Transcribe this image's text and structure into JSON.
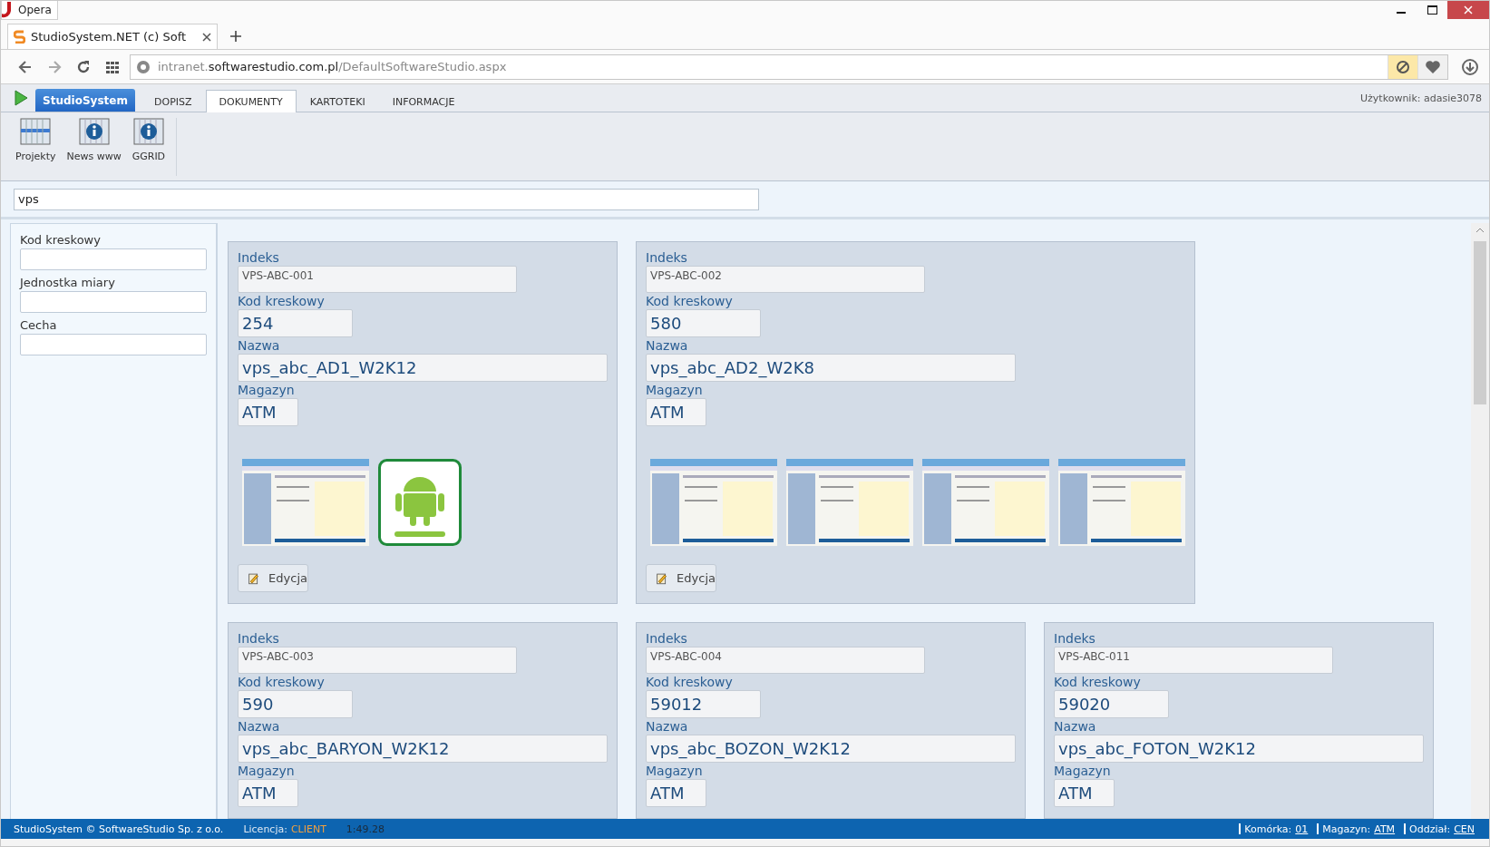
{
  "browser": {
    "title": "Opera",
    "tab": {
      "title": "StudioSystem.NET (c) Soft"
    },
    "url": {
      "prefix": "intranet.",
      "domain": "softwarestudio.com.pl",
      "path": "/DefaultSoftwareStudio.aspx"
    }
  },
  "menu": {
    "brand": "StudioSystem",
    "tabs": [
      {
        "label": "DOPISZ",
        "selected": false
      },
      {
        "label": "DOKUMENTY",
        "selected": true
      },
      {
        "label": "KARTOTEKI",
        "selected": false
      },
      {
        "label": "INFORMACJE",
        "selected": false
      }
    ],
    "user": "Użytkownik: adasie3078"
  },
  "ribbon": [
    {
      "label": "Projekty",
      "kind": "calendar"
    },
    {
      "label": "News www",
      "kind": "info"
    },
    {
      "label": "GGRID",
      "kind": "info"
    }
  ],
  "search": {
    "value": "vps"
  },
  "filters": [
    {
      "label": "Kod kreskowy"
    },
    {
      "label": "Jednostka miary"
    },
    {
      "label": "Cecha"
    }
  ],
  "cards": [
    {
      "fields": [
        {
          "label": "Indeks",
          "value": "VPS-ABC-001",
          "kind": "small"
        },
        {
          "label": "Kod kreskowy",
          "value": "254",
          "kind": "short"
        },
        {
          "label": "Nazwa",
          "value": "vps_abc_AD1_W2K12",
          "kind": "wide"
        },
        {
          "label": "Magazyn",
          "value": "ATM",
          "kind": "tiny"
        }
      ],
      "images": [
        {
          "kind": "screenshot"
        },
        {
          "kind": "logo"
        }
      ],
      "action": "Edycja"
    },
    {
      "fields": [
        {
          "label": "Indeks",
          "value": "VPS-ABC-002",
          "kind": "small"
        },
        {
          "label": "Kod kreskowy",
          "value": "580",
          "kind": "short"
        },
        {
          "label": "Nazwa",
          "value": "vps_abc_AD2_W2K8",
          "kind": "wide"
        },
        {
          "label": "Magazyn",
          "value": "ATM",
          "kind": "tiny"
        }
      ],
      "images": [
        {
          "kind": "screenshot"
        },
        {
          "kind": "screenshot"
        },
        {
          "kind": "screenshot"
        },
        {
          "kind": "screenshot"
        }
      ],
      "action": "Edycja"
    },
    {
      "fields": [
        {
          "label": "Indeks",
          "value": "VPS-ABC-003",
          "kind": "small"
        },
        {
          "label": "Kod kreskowy",
          "value": "590",
          "kind": "short"
        },
        {
          "label": "Nazwa",
          "value": "vps_abc_BARYON_W2K12",
          "kind": "wide"
        },
        {
          "label": "Magazyn",
          "value": "ATM",
          "kind": "tiny"
        }
      ]
    },
    {
      "fields": [
        {
          "label": "Indeks",
          "value": "VPS-ABC-004",
          "kind": "small"
        },
        {
          "label": "Kod kreskowy",
          "value": "59012",
          "kind": "short"
        },
        {
          "label": "Nazwa",
          "value": "vps_abc_BOZON_W2K12",
          "kind": "wide"
        },
        {
          "label": "Magazyn",
          "value": "ATM",
          "kind": "tiny"
        }
      ]
    },
    {
      "fields": [
        {
          "label": "Indeks",
          "value": "VPS-ABC-011",
          "kind": "small"
        },
        {
          "label": "Kod kreskowy",
          "value": "59020",
          "kind": "short"
        },
        {
          "label": "Nazwa",
          "value": "vps_abc_FOTON_W2K12",
          "kind": "wide"
        },
        {
          "label": "Magazyn",
          "value": "ATM",
          "kind": "tiny"
        }
      ]
    }
  ],
  "status": {
    "copyright": "StudioSystem © SoftwareStudio Sp. z o.o.",
    "license_label": "Licencja:",
    "license": "CLIENT",
    "time": "1:49.28",
    "items": [
      {
        "label": "Komórka:",
        "value": "01"
      },
      {
        "label": "Magazyn:",
        "value": "ATM"
      },
      {
        "label": "Oddział:",
        "value": "CEN"
      }
    ]
  }
}
